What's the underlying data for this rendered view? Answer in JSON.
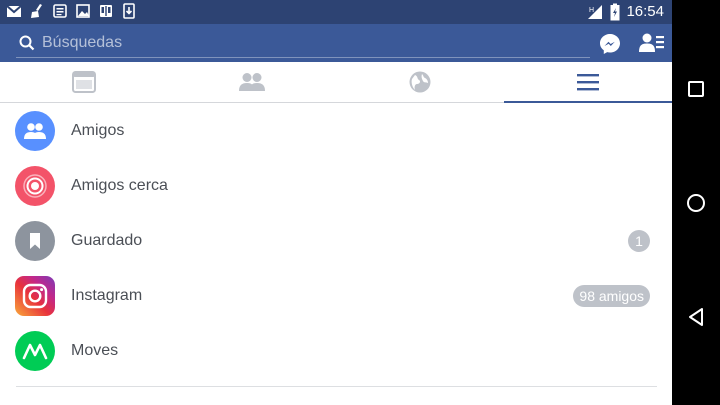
{
  "status_bar": {
    "time": "16:54",
    "notification_icons": [
      "gmail-icon",
      "broom-icon",
      "news-icon",
      "image-icon",
      "book-icon",
      "download-icon"
    ],
    "signal_icon": "signal-icon",
    "battery_icon": "battery-icon"
  },
  "search": {
    "placeholder": "Búsquedas",
    "icon": "search-icon"
  },
  "header_actions": [
    "messenger-icon",
    "friend-requests-icon"
  ],
  "tabs": [
    {
      "icon": "news-feed-icon",
      "active": false
    },
    {
      "icon": "friends-icon",
      "active": false
    },
    {
      "icon": "globe-icon",
      "active": false
    },
    {
      "icon": "menu-icon",
      "active": true
    }
  ],
  "menu_items": [
    {
      "label": "Amigos",
      "icon": "friends-icon",
      "color": "#5890ff"
    },
    {
      "label": "Amigos cerca",
      "icon": "nearby-icon",
      "color": "#f35369"
    },
    {
      "label": "Guardado",
      "icon": "bookmark-icon",
      "color": "#8d949e",
      "badge": "1"
    },
    {
      "label": "Instagram",
      "icon": "instagram-icon",
      "badge": "98 amigos"
    },
    {
      "label": "Moves",
      "icon": "moves-icon",
      "color": "#00cc55"
    }
  ],
  "colors": {
    "brand": "#3b5998",
    "status_bar": "#2d4373",
    "tab_inactive": "#bec2c9",
    "text": "#4b4f56",
    "badge": "#bec2c9"
  },
  "system_nav": [
    "recents-icon",
    "home-icon",
    "back-icon"
  ]
}
